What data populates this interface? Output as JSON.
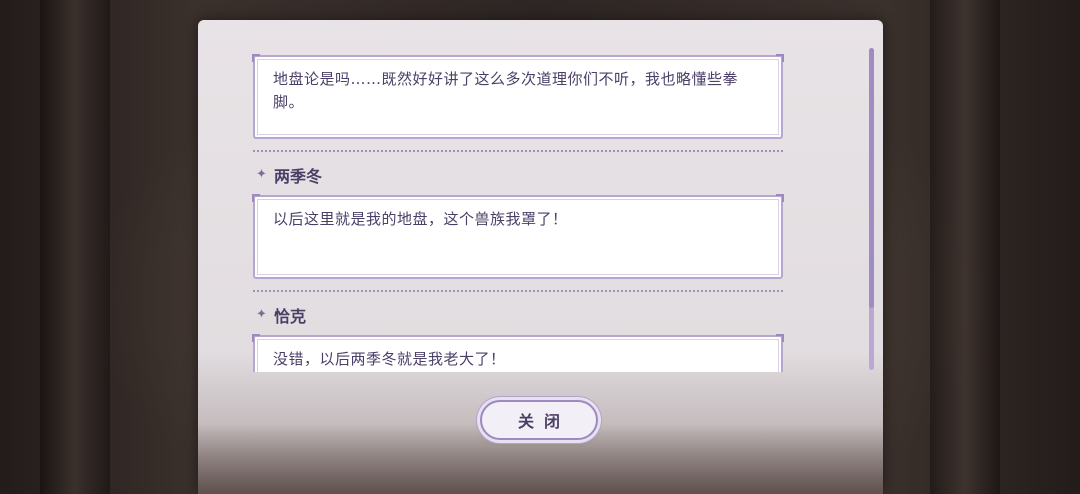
{
  "dialog_log": {
    "entries": [
      {
        "speaker": "",
        "text": "地盘论是吗……既然好好讲了这么多次道理你们不听，我也略懂些拳脚。"
      },
      {
        "speaker": "两季冬",
        "text": "以后这里就是我的地盘，这个兽族我罩了！"
      },
      {
        "speaker": "恰克",
        "text": "没错，以后两季冬就是我老大了！"
      }
    ],
    "close_label": "关闭"
  },
  "colors": {
    "accent": "#9c89bf",
    "text": "#4b3f68",
    "panel": "#e5e0e3"
  },
  "icons": {
    "speaker_marker": "sparkle-icon"
  }
}
